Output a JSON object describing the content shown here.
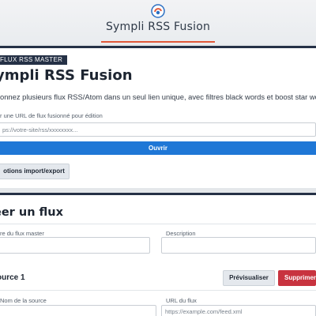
{
  "header": {
    "app_title": "Sympli RSS Fusion",
    "logo": "sympli-logo-icon",
    "accent_color": "#e1593a"
  },
  "intro": {
    "badge": "FLUX RSS MASTER",
    "heading": "ympli RSS Fusion",
    "description": "onnez plusieurs flux RSS/Atom dans un seul lien unique, avec filtres black words et boost star words",
    "edit_label": "r une URL de flux fusionné pour édition",
    "edit_placeholder": "ps://votre-site/rss/xxxxxxxx...",
    "open_button": "Ouvrir",
    "options_button": "otions import/export"
  },
  "create": {
    "title": "éer un flux",
    "master_name_label": "re du flux master",
    "description_label": "Description",
    "source": {
      "title": "ource 1",
      "preview_button": "Prévisualiser",
      "delete_button": "Supprimer",
      "name_label": "Nom de la source",
      "url_label": "URL du flux",
      "url_placeholder": "https://example.com/feed.xml"
    }
  },
  "colors": {
    "primary": "#1f77d6",
    "danger": "#c8333f",
    "dark": "#253146"
  }
}
